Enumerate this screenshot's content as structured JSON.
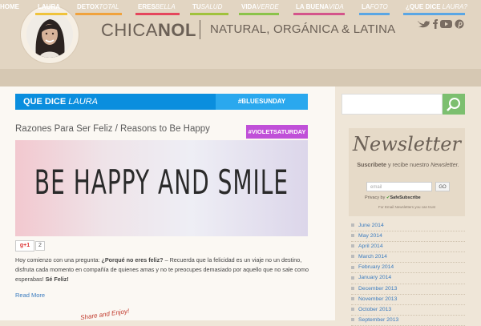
{
  "header": {
    "logo_light": "CHICA",
    "logo_bold": "NOL",
    "tagline": "NATURAL, ORGÁNICA & LATINA",
    "social_icons": [
      "twitter-icon",
      "facebook-icon",
      "youtube-icon",
      "pinterest-icon"
    ]
  },
  "nav": {
    "items": [
      {
        "label_a": "HOME",
        "label_b": "",
        "color": "#ffffff"
      },
      {
        "label_a": "LAURA",
        "label_b": "",
        "color": "#f0c33c"
      },
      {
        "label_a": "DETOX",
        "label_b": "TOTAL",
        "color": "#f0a23c"
      },
      {
        "label_a": "ERES",
        "label_b": "BELLA",
        "color": "#e5465c"
      },
      {
        "label_a": "TU",
        "label_b": "SALUD",
        "color": "#a0c23c"
      },
      {
        "label_a": "VIDA",
        "label_b": "VERDE",
        "color": "#8bc34a"
      },
      {
        "label_a": "LA BUENA",
        "label_b": "VIDA",
        "color": "#d4548b"
      },
      {
        "label_a": "LA",
        "label_b": "FOTO",
        "color": "#5aa6e4"
      },
      {
        "label_a": "¿QUE DICE",
        "label_b": "LAURA?",
        "color": "#5aa6e4"
      }
    ]
  },
  "banner": {
    "left_bold": "QUE DICE",
    "left_italic": "LAURA",
    "right": "#BLUESUNDAY",
    "color_left": "#0a8ede",
    "color_right": "#2aa8ee"
  },
  "post": {
    "title": "Razones Para Ser Feliz / Reasons to Be Happy",
    "badge": "#VIOLETSATURDAY",
    "badge_color": "#c050d8",
    "hero_text": "BE HAPPY AND SMILE",
    "gplus": "g+1",
    "gplus_count": "2",
    "intro_1": "Hoy comienzo con una pregunta: ",
    "intro_bold_1": "¿Porqué no eres feliz?",
    "intro_2": " – Recuerda que la felicidad es un viaje no un destino, disfruta cada momento en compañía de quienes amas y no te preocupes demasiado por aquello que no sale como esperabas! ",
    "intro_bold_2": "Sé Feliz!",
    "read_more": "Read More",
    "share": "Share and Enjoy!"
  },
  "sidebar": {
    "search": {
      "placeholder": ""
    },
    "newsletter": {
      "title": "Newsletter",
      "sub_bold": "Suscribete",
      "sub_text": " y recibe nuestro ",
      "sub_italic": "Newsletter.",
      "email_placeholder": "email",
      "go_label": "GO",
      "privacy_label": "Privacy by",
      "privacy_brand": "SafeSubscribe",
      "footer": "For Email Newsletters you can trust"
    },
    "archive": [
      "June 2014",
      "May 2014",
      "April 2014",
      "March 2014",
      "February 2014",
      "January 2014",
      "December 2013",
      "November 2013",
      "October 2013",
      "September 2013"
    ]
  }
}
